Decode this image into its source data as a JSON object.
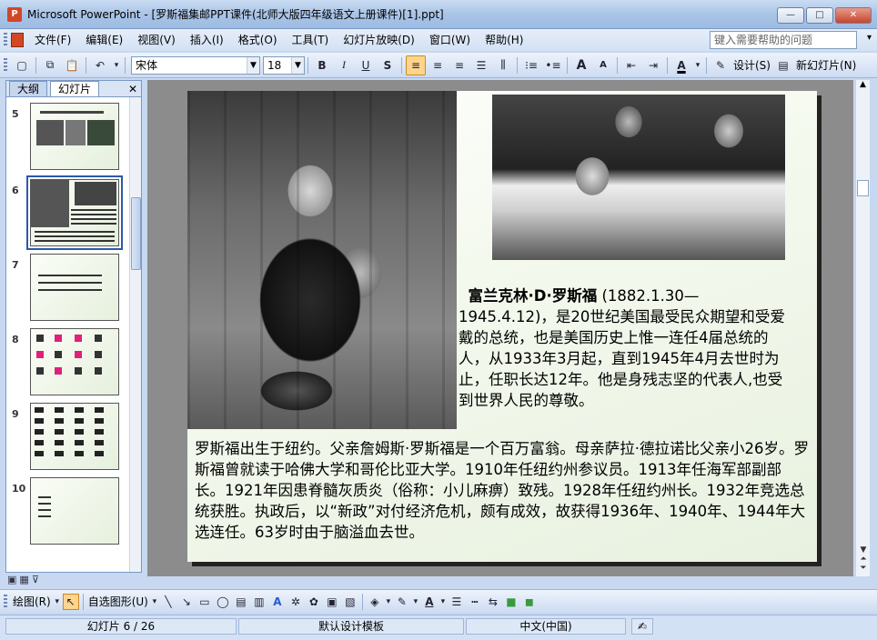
{
  "window": {
    "app_icon_letter": "P",
    "title": "Microsoft PowerPoint - [罗斯福集邮PPT课件(北师大版四年级语文上册课件)[1].ppt]",
    "buttons": {
      "minimize": "—",
      "maximize": "□",
      "close": "✕"
    }
  },
  "menu": {
    "items": [
      "文件(F)",
      "编辑(E)",
      "视图(V)",
      "插入(I)",
      "格式(O)",
      "工具(T)",
      "幻灯片放映(D)",
      "窗口(W)",
      "帮助(H)"
    ],
    "help_placeholder": "键入需要帮助的问题",
    "help_arrow": "▾"
  },
  "toolbar": {
    "font_name": "宋体",
    "font_size": "18",
    "bold": "B",
    "italic": "I",
    "underline": "U",
    "shadow": "S",
    "design_label": "设计(S)",
    "new_slide_label": "新幻灯片(N)",
    "font_color_letter": "A",
    "grow_font": "A",
    "shrink_font": "A"
  },
  "pane": {
    "tabs": [
      "大纲",
      "幻灯片"
    ],
    "close": "✕",
    "thumbs": [
      {
        "num": "5"
      },
      {
        "num": "6"
      },
      {
        "num": "7"
      },
      {
        "num": "8"
      },
      {
        "num": "9"
      },
      {
        "num": "10"
      }
    ],
    "selected_num": "6"
  },
  "slide": {
    "caption_name": "富兰克林·D·罗斯福",
    "caption_rest": " (1882.1.30—1945.4.12)，是20世纪美国最受民众期望和受爱戴的总统，也是美国历史上惟一连任4届总统的人，从1933年3月起，直到1945年4月去世时为止，任职长达12年。他是身残志坚的代表人,也受到世界人民的尊敬。",
    "paragraph": "罗斯福出生于纽约。父亲詹姆斯·罗斯福是一个百万富翁。母亲萨拉·德拉诺比父亲小26岁。罗斯福曾就读于哈佛大学和哥伦比亚大学。1910年任纽约州参议员。1913年任海军部副部长。1921年因患脊髓灰质炎（俗称：小儿麻痹）致残。1928年任纽约州长。1932年竞选总统获胜。执政后，以“新政”对付经济危机，颇有成效，故获得1936年、1940年、1944年大选连任。63岁时由于脑溢血去世。"
  },
  "drawbar": {
    "draw_label": "绘图(R)",
    "autoshape_label": "自选图形(U)"
  },
  "status": {
    "slide_pos": "幻灯片 6 / 26",
    "template": "默认设计模板",
    "language": "中文(中国)"
  }
}
